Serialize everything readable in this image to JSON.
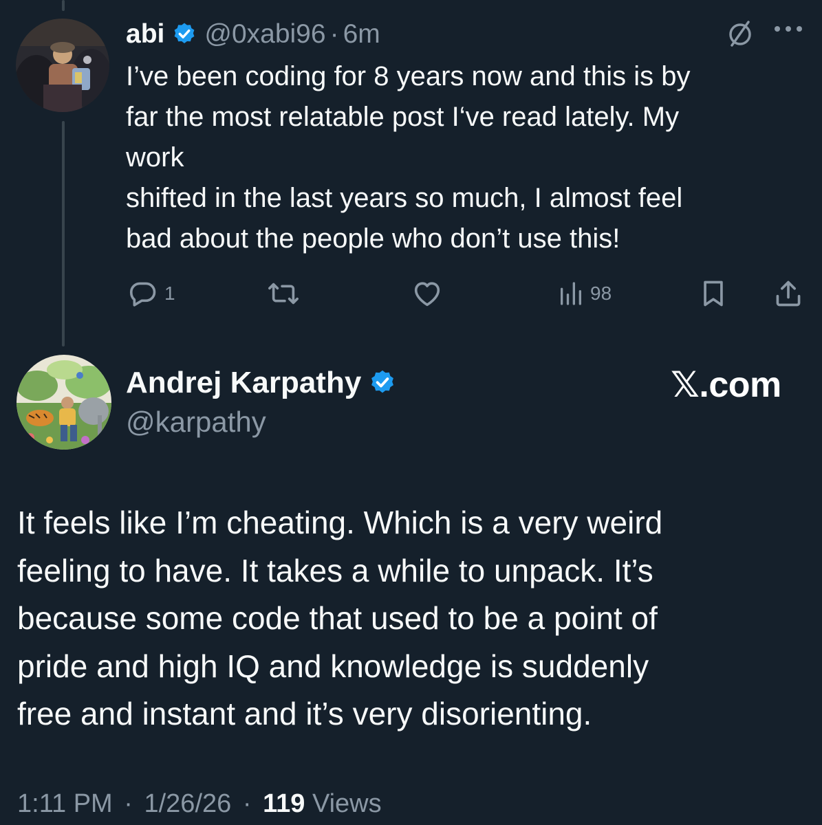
{
  "reply": {
    "name": "abi",
    "handle": "@0xabi96",
    "separator": "·",
    "time": "6m",
    "text_lines": [
      "I’ve been coding for 8 years now and this is by",
      "far the most relatable post I‘ve read lately. My",
      "work",
      "shifted in the last years so much, I almost feel",
      "bad about the people who don’t use this!"
    ],
    "actions": {
      "reply_count": "1",
      "views_count": "98"
    },
    "icons": [
      "verified-badge-icon",
      "grok-icon",
      "more-icon",
      "reply-icon",
      "repost-icon",
      "like-icon",
      "views-icon",
      "bookmark-icon",
      "share-icon"
    ]
  },
  "post": {
    "name": "Andrej Karpathy",
    "handle": "@karpathy",
    "brand": "𝕏.com",
    "text_lines": [
      "It feels like I’m cheating. Which is a very weird",
      "feeling to have. It takes a while to unpack. It’s",
      "because some code that used to be a point of",
      "pride and high IQ and knowledge is suddenly",
      "free and instant and it’s very disorienting."
    ],
    "time": "1:11 PM",
    "date": "1/26/26",
    "separator": "·",
    "views_count": "119",
    "views_label": "Views"
  },
  "colors": {
    "background": "#15202b",
    "text": "#f7f9f9",
    "muted": "#8b98a5",
    "verified": "#1d9bf0",
    "thread_line": "#38444d"
  }
}
